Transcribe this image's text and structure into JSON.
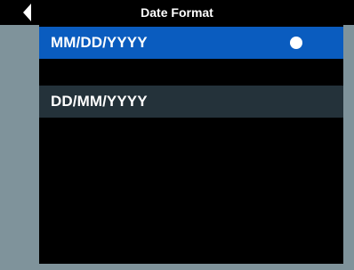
{
  "header": {
    "title": "Date Format",
    "back_icon": "back-arrow-icon"
  },
  "colors": {
    "screen_background": "#7f939b",
    "header_background": "#000000",
    "list_background": "#000000",
    "selected_item_background": "#0a5cbf",
    "normal_item_background": "#24323a",
    "text": "#ffffff"
  },
  "date_formats": {
    "selected_index": 0,
    "selected_indicator_icon": "selected-dot-icon",
    "items": [
      {
        "label": "MM/DD/YYYY",
        "selected": true
      },
      {
        "label": "DD/MM/YYYY",
        "selected": false
      }
    ]
  }
}
